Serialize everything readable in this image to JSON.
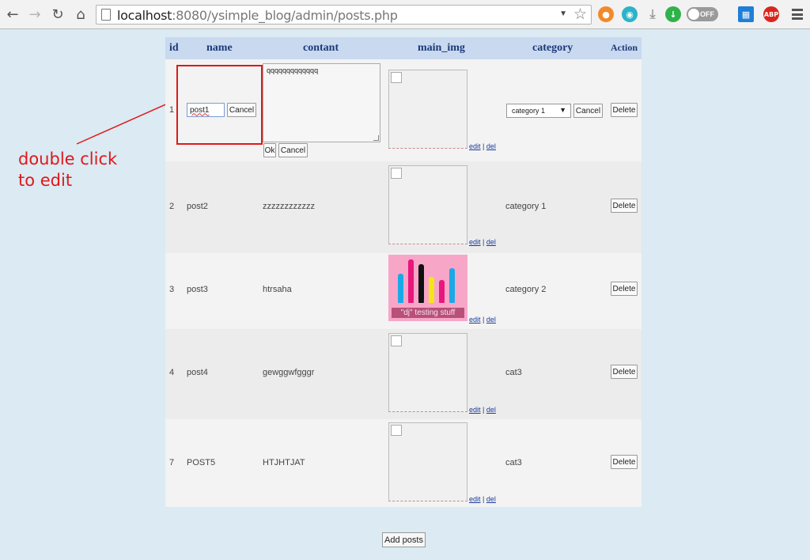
{
  "browser": {
    "url_host": "localhost",
    "url_rest": ":8080/ysimple_blog/admin/posts.php",
    "toggle_label": "OFF",
    "abp_label": "ABP"
  },
  "table": {
    "headers": {
      "id": "id",
      "name": "name",
      "contant": "contant",
      "main_img": "main_img",
      "category": "category",
      "action": "Action"
    },
    "editing_row": {
      "id": "1",
      "name_value": "post1",
      "name_cancel": "Cancel",
      "content_value": "qqqqqqqqqqqqq",
      "content_ok": "Ok",
      "content_cancel": "Cancel",
      "category_selected": "category 1",
      "category_cancel": "Cancel",
      "delete_label": "Delete"
    },
    "rows": [
      {
        "id": "2",
        "name": "post2",
        "content": "zzzzzzzzzzzz",
        "category": "category 1",
        "delete_label": "Delete"
      },
      {
        "id": "3",
        "name": "post3",
        "content": "htrsaha",
        "category": "category 2",
        "delete_label": "Delete"
      },
      {
        "id": "4",
        "name": "post4",
        "content": "gewggwfgggr",
        "category": "cat3",
        "delete_label": "Delete"
      },
      {
        "id": "7",
        "name": "POST5",
        "content": "HTJHTJAT",
        "category": "cat3",
        "delete_label": "Delete"
      }
    ],
    "img_links": {
      "edit": "edit",
      "separator": "|",
      "del": "del"
    },
    "thumb_caption": "\"dj\" testing stuff"
  },
  "annotation": {
    "line1": "double click",
    "line2": "to edit"
  },
  "add_posts_label": "Add posts",
  "colors": {
    "annotation": "#e01818",
    "header_bg": "#c9d9ef",
    "page_bg": "#dbeaf3"
  }
}
